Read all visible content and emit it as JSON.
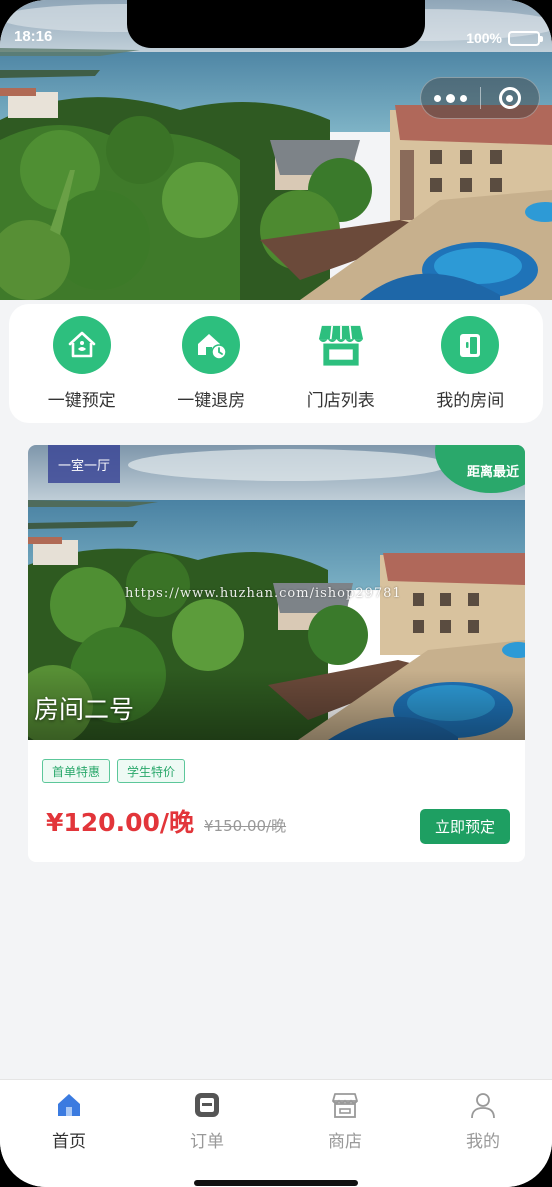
{
  "status_bar": {
    "time": "18:16",
    "battery": "100%"
  },
  "capsule": {
    "more_icon": "more-dots-icon",
    "close_icon": "target-circle-icon"
  },
  "quick_menu": [
    {
      "label": "一键预定",
      "icon": "booking-house-icon"
    },
    {
      "label": "一键退房",
      "icon": "house-clock-icon"
    },
    {
      "label": "门店列表",
      "icon": "store-awning-icon"
    },
    {
      "label": "我的房间",
      "icon": "door-icon"
    }
  ],
  "room": {
    "type_badge": "一室一厅",
    "corner_badge": "距离最近",
    "name": "房间二号",
    "watermark": "https://www.huzhan.com/ishop29781",
    "tags": [
      "首单特惠",
      "学生特价"
    ],
    "price": "¥120.00/晚",
    "original_price": "¥150.00/晚",
    "book_label": "立即预定"
  },
  "tabbar": [
    {
      "label": "首页",
      "icon": "home-icon",
      "active": true
    },
    {
      "label": "订单",
      "icon": "order-icon",
      "active": false
    },
    {
      "label": "商店",
      "icon": "shop-icon",
      "active": false
    },
    {
      "label": "我的",
      "icon": "user-icon",
      "active": false
    }
  ],
  "colors": {
    "accent_green": "#2dbf7e",
    "price_red": "#e2353a",
    "button_green": "#1e9f62",
    "tab_active_blue": "#3b7be0"
  }
}
